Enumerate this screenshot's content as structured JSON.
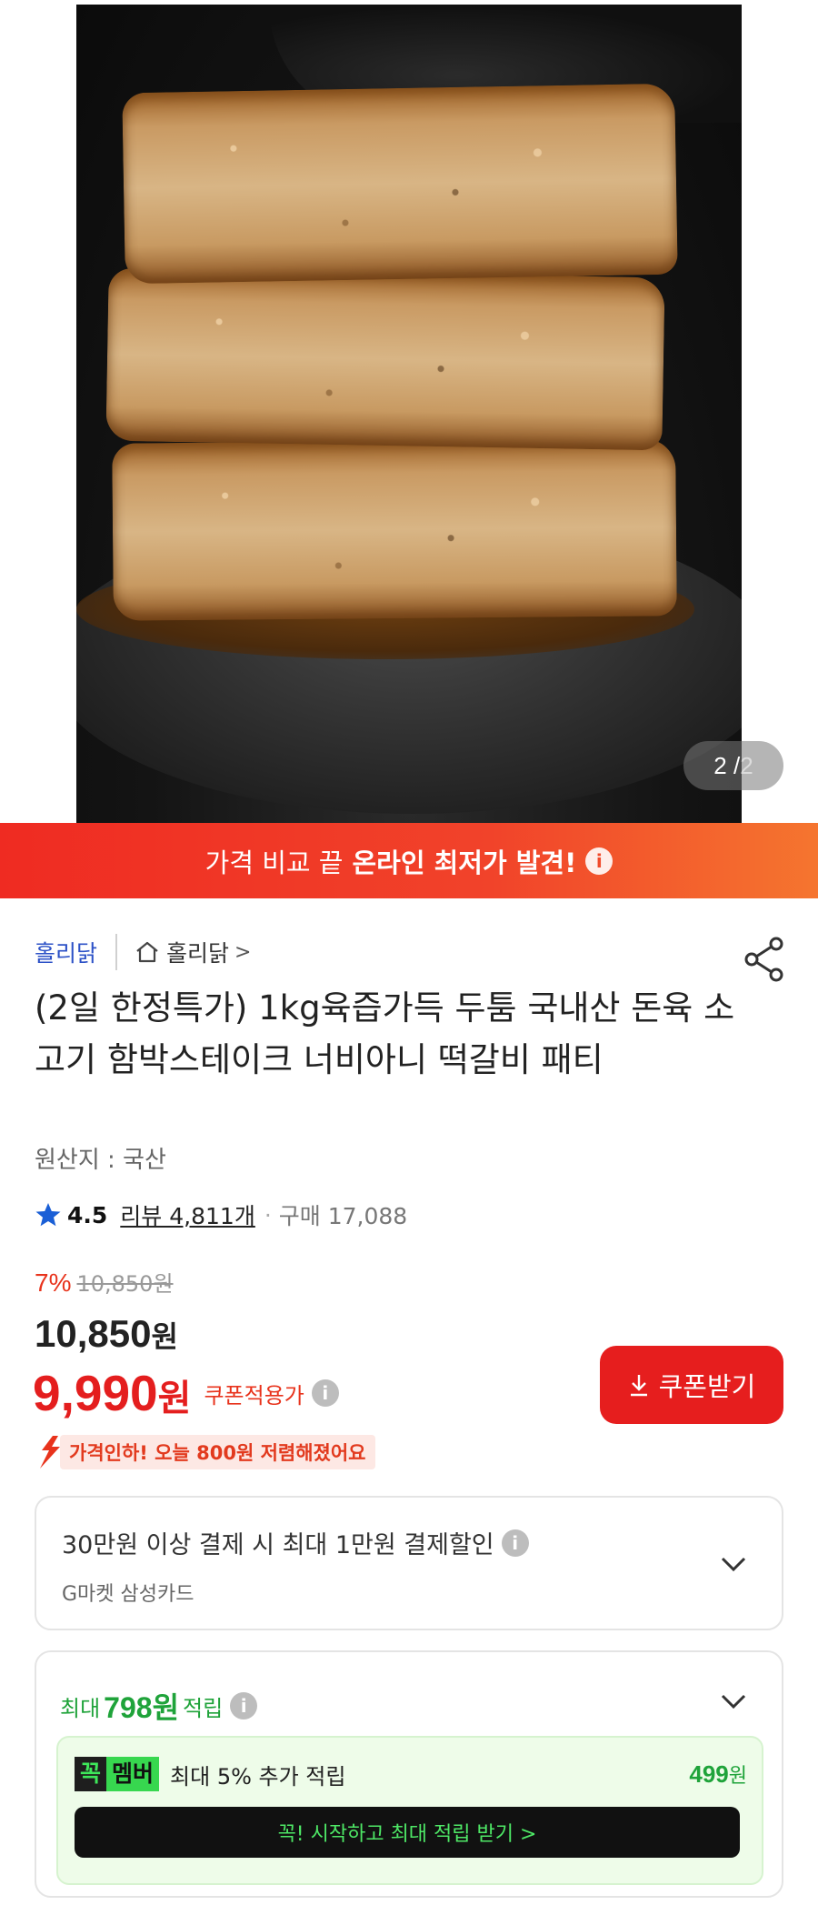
{
  "gallery": {
    "current": "2 /",
    "total": "2"
  },
  "banner": {
    "prefix": "가격 비교 끝",
    "highlight": "온라인 최저가 발견!",
    "info_icon": "i"
  },
  "seller": {
    "brand": "홀리닭",
    "store": "홀리닭",
    "chevron": ">"
  },
  "product": {
    "title": "(2일 한정특가) 1kg육즙가득 두툼 국내산 돈육 소고기 함박스테이크 너비아니 떡갈비 패티",
    "origin": "원산지 : 국산"
  },
  "rating": {
    "score": "4.5",
    "reviews": "리뷰 4,811개",
    "separator": "·",
    "purchases": "구매 17,088"
  },
  "price": {
    "discount": "7%",
    "original": "10,850원",
    "current_number": "10,850",
    "current_unit": "원",
    "coupon_number": "9,990",
    "coupon_unit": "원",
    "coupon_label": "쿠폰적용가",
    "info_icon": "i",
    "coupon_button": "쿠폰받기",
    "drop_notice": "가격인하! 오늘 800원 저렴해졌어요"
  },
  "card_benefit": {
    "line": "30만원 이상 결제 시 최대 1만원 결제할인",
    "card": "G마켓 삼성카드",
    "info_icon": "i"
  },
  "points": {
    "prefix": "최대",
    "amount": "798원",
    "suffix": "적립",
    "info_icon": "i",
    "member_logo_a": "꼭",
    "member_logo_b": "멤버",
    "member_text": "최대 5% 추가 적립",
    "member_amount_number": "499",
    "member_amount_unit": "원",
    "member_button": "꼭! 시작하고 최대 적립 받기 >"
  },
  "colors": {
    "accent_red": "#e61e1e",
    "brand_blue": "#2d52c7",
    "green": "#1fa33a",
    "star_blue": "#1a5fd6"
  }
}
